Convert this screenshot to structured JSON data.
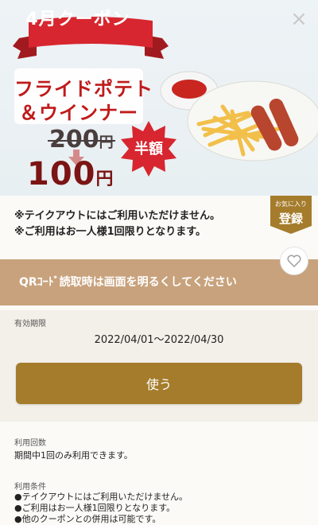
{
  "hero": {
    "banner_label": "4月クーポン",
    "product_name_line1": "フライドポテト",
    "product_name_line2": "＆ウインナー",
    "old_price_value": "200",
    "old_price_unit": "円",
    "new_price_value": "100",
    "new_price_unit": "円",
    "discount_badge": "半額"
  },
  "favorite": {
    "small_label": "お気に入り",
    "big_label": "登録"
  },
  "notes": [
    "※テイクアウトにはご利用いただけません。",
    "※ご利用はお一人様1回限りとなります。"
  ],
  "qr_instruction": "QRｺｰﾄﾞ読取時は画面を明るくしてください",
  "validity": {
    "label": "有効期限",
    "dates": "2022/04/01～2022/04/30"
  },
  "use_button_label": "使う",
  "usage_count": {
    "label": "利用回数",
    "text": "期間中1回のみ利用できます。"
  },
  "usage_conditions": {
    "label": "利用条件",
    "items": [
      "●テイクアウトにはご利用いただけません。",
      "●ご利用はお一人様1回限りとなります。",
      "●他のクーポンとの併用は可能です。"
    ]
  },
  "colors": {
    "brand_brown": "#a47c2b",
    "qr_bar": "#c8a27c",
    "banner_red": "#d7262f",
    "price_dark_red": "#7b1414"
  }
}
